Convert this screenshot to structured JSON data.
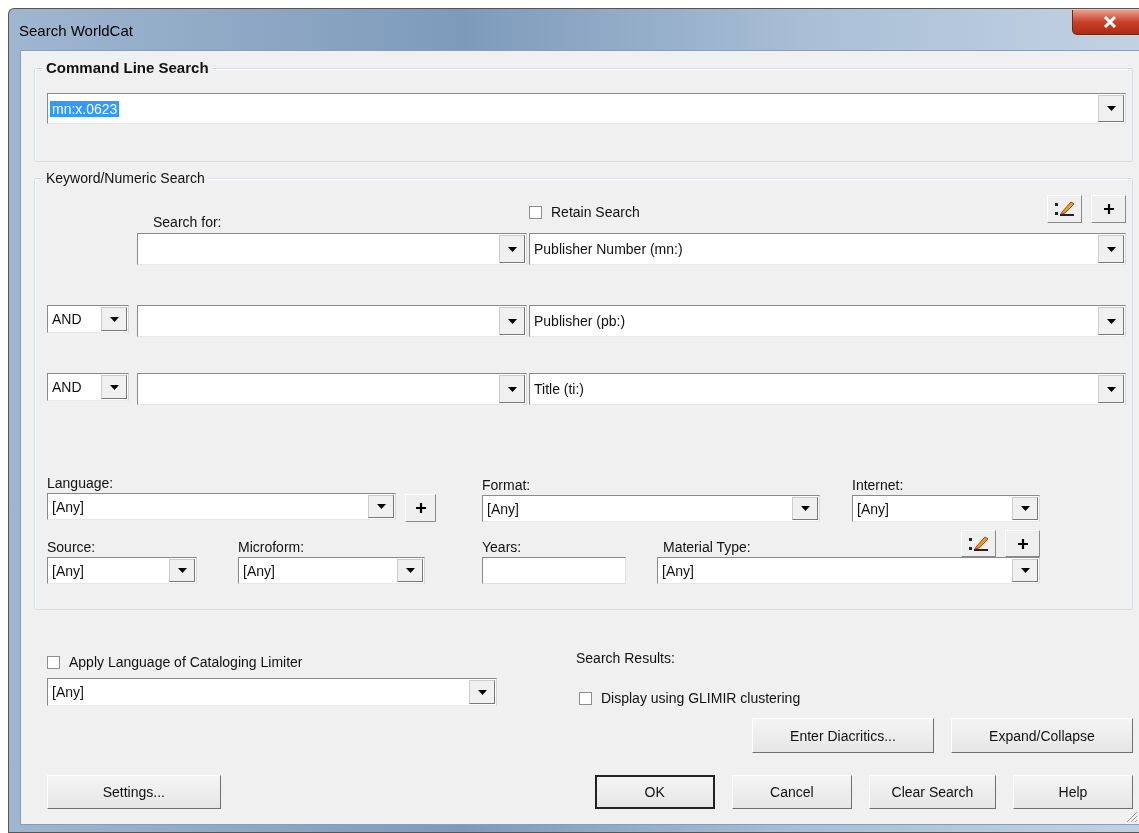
{
  "window": {
    "title": "Search WorldCat"
  },
  "command_line_search": {
    "label": "Command Line Search",
    "value": "mn:x.0623",
    "text_selected": true
  },
  "keyword_search": {
    "label": "Keyword/Numeric Search",
    "search_for_label": "Search for:",
    "retain_search": {
      "label": "Retain Search",
      "checked": false
    },
    "rows": [
      {
        "index": "Publisher Number (mn:)"
      },
      {
        "operator": "AND",
        "index": "Publisher (pb:)"
      },
      {
        "operator": "AND",
        "index": "Title (ti:)"
      }
    ],
    "limiters": [
      {
        "kind": "dropdown",
        "label": "Language:",
        "value": "[Any]"
      },
      {
        "kind": "dropdown",
        "label": "Format:",
        "value": "[Any]"
      },
      {
        "kind": "dropdown",
        "label": "Internet:",
        "value": "[Any]"
      },
      {
        "kind": "dropdown",
        "label": "Source:",
        "value": "[Any]"
      },
      {
        "kind": "dropdown",
        "label": "Microform:",
        "value": "[Any]"
      },
      {
        "kind": "text",
        "label": "Years:"
      },
      {
        "kind": "dropdown",
        "label": "Material Type:",
        "value": "[Any]"
      }
    ]
  },
  "cataloging_language": {
    "label": "Apply Language of Cataloging Limiter",
    "checked": false,
    "value": "[Any]"
  },
  "search_results": {
    "label": "Search Results:",
    "glimir": {
      "label": "Display using GLIMIR clustering",
      "checked": false
    }
  },
  "action_buttons": [
    "Enter Diacritics...",
    "Expand/Collapse"
  ],
  "dialog_buttons": [
    {
      "label": "Settings...",
      "default": false
    },
    {
      "label": "OK",
      "default": true
    },
    {
      "label": "Cancel",
      "default": false
    },
    {
      "label": "Clear Search",
      "default": false
    },
    {
      "label": "Help",
      "default": false
    }
  ]
}
